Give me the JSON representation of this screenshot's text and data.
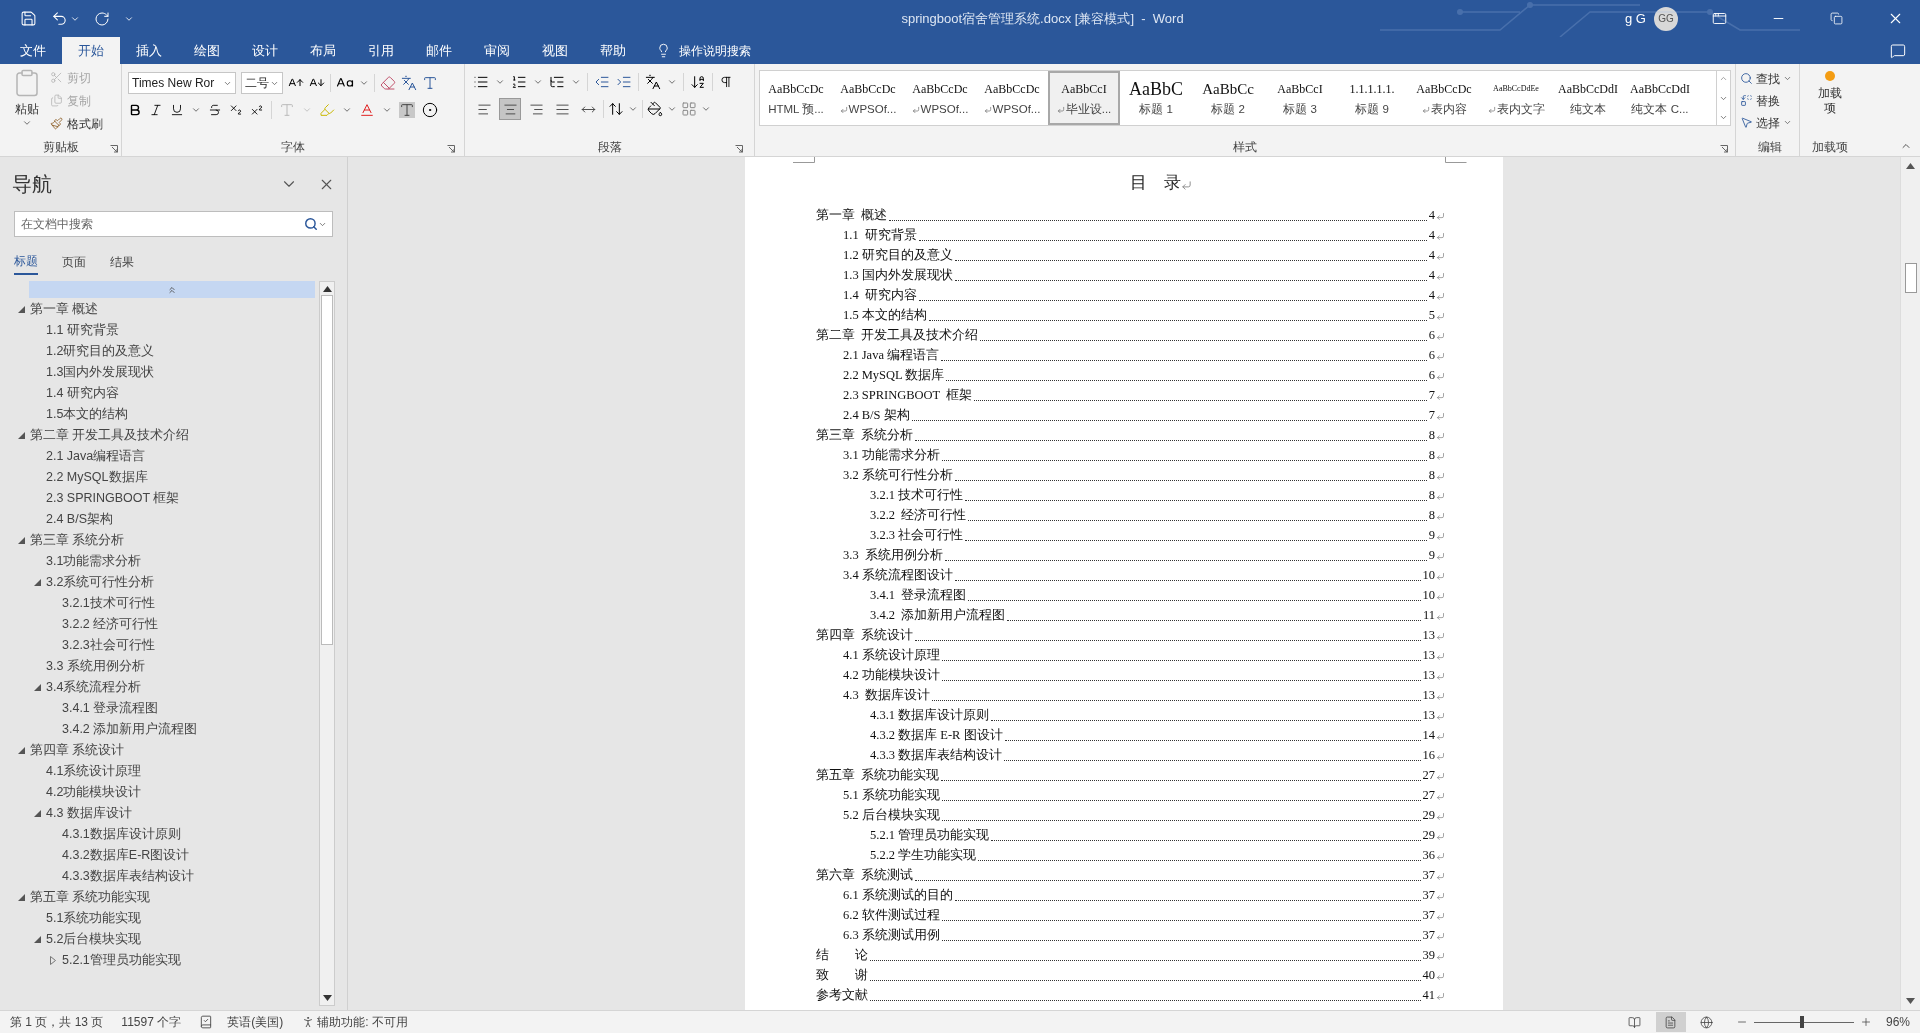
{
  "window": {
    "title": "springboot宿舍管理系统.docx [兼容模式]  -  Word",
    "user": "g G",
    "avatar": "GG"
  },
  "tabs": [
    {
      "label": "文件",
      "selected": false
    },
    {
      "label": "开始",
      "selected": true
    },
    {
      "label": "插入",
      "selected": false
    },
    {
      "label": "绘图",
      "selected": false
    },
    {
      "label": "设计",
      "selected": false
    },
    {
      "label": "布局",
      "selected": false
    },
    {
      "label": "引用",
      "selected": false
    },
    {
      "label": "邮件",
      "selected": false
    },
    {
      "label": "审阅",
      "selected": false
    },
    {
      "label": "视图",
      "selected": false
    },
    {
      "label": "帮助",
      "selected": false
    }
  ],
  "tell_me": "操作说明搜索",
  "ribbon": {
    "clipboard": {
      "group": "剪贴板",
      "paste": {
        "label": "粘贴",
        "disabled": true
      },
      "items": [
        {
          "kind": "cut",
          "label": "剪切",
          "disabled": true
        },
        {
          "kind": "copy",
          "label": "复制",
          "disabled": true
        },
        {
          "kind": "painter",
          "label": "格式刷",
          "disabled": false
        }
      ]
    },
    "font": {
      "group": "字体",
      "name": "Times New Ror",
      "size": "二号"
    },
    "paragraph": {
      "group": "段落",
      "align_buttons": [
        {
          "kind": "left",
          "selected": false
        },
        {
          "kind": "center",
          "selected": true
        },
        {
          "kind": "right",
          "selected": false
        },
        {
          "kind": "justify",
          "selected": false
        },
        {
          "kind": "distributed",
          "selected": false
        }
      ]
    },
    "styles": {
      "group": "样式",
      "items": [
        {
          "preview": "AaBbCcDc",
          "label": "HTML 预...",
          "kind": "normal",
          "linked": false,
          "selected": false
        },
        {
          "preview": "AaBbCcDc",
          "label": "WPSOf...",
          "kind": "normal",
          "linked": true,
          "selected": false
        },
        {
          "preview": "AaBbCcDc",
          "label": "WPSOf...",
          "kind": "normal",
          "linked": true,
          "selected": false
        },
        {
          "preview": "AaBbCcDc",
          "label": "WPSOf...",
          "kind": "normal",
          "linked": true,
          "selected": false
        },
        {
          "preview": "AaBbCcI",
          "label": "毕业设...",
          "kind": "normal",
          "linked": true,
          "selected": true
        },
        {
          "preview": "AaBbC",
          "label": "标题 1",
          "kind": "title",
          "linked": false,
          "selected": false
        },
        {
          "preview": "AaBbCc",
          "label": "标题 2",
          "kind": "heading",
          "linked": false,
          "selected": false
        },
        {
          "preview": "AaBbCcI",
          "label": "标题 3",
          "kind": "normal",
          "linked": false,
          "selected": false
        },
        {
          "preview": "1.1.1.1.1.",
          "label": "标题 9",
          "kind": "normal",
          "linked": false,
          "selected": false
        },
        {
          "preview": "AaBbCcDc",
          "label": "表内容",
          "kind": "normal",
          "linked": true,
          "selected": false
        },
        {
          "preview": "AaBbCcDdEe",
          "label": "表内文字",
          "kind": "small",
          "linked": true,
          "selected": false
        },
        {
          "preview": "AaBbCcDdI",
          "label": "纯文本",
          "kind": "normal",
          "linked": false,
          "selected": false
        },
        {
          "preview": "AaBbCcDdI",
          "label": "纯文本 C...",
          "kind": "normal",
          "linked": false,
          "selected": false
        }
      ]
    },
    "editing": {
      "group": "编辑",
      "items": [
        {
          "kind": "find",
          "label": "查找"
        },
        {
          "kind": "replace",
          "label": "替换"
        },
        {
          "kind": "select",
          "label": "选择"
        }
      ]
    },
    "addins": {
      "group": "加载项",
      "button": "加载项"
    }
  },
  "nav": {
    "title": "导航",
    "search": {
      "placeholder": "在文档中搜索"
    },
    "tabs": [
      {
        "label": "标题",
        "selected": true
      },
      {
        "label": "页面",
        "selected": false
      },
      {
        "label": "结果",
        "selected": false
      }
    ],
    "tree": [
      {
        "label": "第一章 概述",
        "expanded": true,
        "children": [
          {
            "label": "1.1 研究背景"
          },
          {
            "label": "1.2研究目的及意义"
          },
          {
            "label": "1.3国内外发展现状"
          },
          {
            "label": "1.4 研究内容"
          },
          {
            "label": "1.5本文的结构"
          }
        ]
      },
      {
        "label": "第二章 开发工具及技术介绍",
        "expanded": true,
        "children": [
          {
            "label": "2.1 Java编程语言"
          },
          {
            "label": "2.2 MySQL数据库"
          },
          {
            "label": "2.3 SPRINGBOOT 框架"
          },
          {
            "label": "2.4 B/S架构"
          }
        ]
      },
      {
        "label": "第三章 系统分析",
        "expanded": true,
        "children": [
          {
            "label": "3.1功能需求分析"
          },
          {
            "label": "3.2系统可行性分析",
            "expanded": true,
            "children": [
              {
                "label": "3.2.1技术可行性"
              },
              {
                "label": "3.2.2 经济可行性"
              },
              {
                "label": "3.2.3社会可行性"
              }
            ]
          },
          {
            "label": "3.3 系统用例分析"
          },
          {
            "label": "3.4系统流程分析",
            "expanded": true,
            "children": [
              {
                "label": "3.4.1 登录流程图"
              },
              {
                "label": "3.4.2 添加新用户流程图"
              }
            ]
          }
        ]
      },
      {
        "label": "第四章 系统设计",
        "expanded": true,
        "children": [
          {
            "label": "4.1系统设计原理"
          },
          {
            "label": "4.2功能模块设计"
          },
          {
            "label": "4.3 数据库设计",
            "expanded": true,
            "children": [
              {
                "label": "4.3.1数据库设计原则"
              },
              {
                "label": "4.3.2数据库E-R图设计"
              },
              {
                "label": "4.3.3数据库表结构设计"
              }
            ]
          }
        ]
      },
      {
        "label": "第五章 系统功能实现",
        "expanded": true,
        "children": [
          {
            "label": "5.1系统功能实现"
          },
          {
            "label": "5.2后台模块实现",
            "expanded": true,
            "children": [
              {
                "label": "5.2.1管理员功能实现",
                "expanded": false
              }
            ]
          }
        ]
      }
    ]
  },
  "document": {
    "title": "目　录",
    "toc": [
      {
        "title": "第一章  概述",
        "page": "4",
        "children": [
          {
            "title": "1.1  研究背景",
            "page": "4"
          },
          {
            "title": "1.2 研究目的及意义",
            "page": "4"
          },
          {
            "title": "1.3 国内外发展现状",
            "page": "4"
          },
          {
            "title": "1.4  研究内容",
            "page": "4"
          },
          {
            "title": "1.5 本文的结构",
            "page": "5"
          }
        ]
      },
      {
        "title": "第二章  开发工具及技术介绍",
        "page": "6",
        "children": [
          {
            "title": "2.1 Java 编程语言",
            "page": "6"
          },
          {
            "title": "2.2 MySQL 数据库",
            "page": "6"
          },
          {
            "title": "2.3 SPRINGBOOT  框架",
            "page": "7"
          },
          {
            "title": "2.4 B/S 架构",
            "page": "7"
          }
        ]
      },
      {
        "title": "第三章  系统分析",
        "page": "8",
        "children": [
          {
            "title": "3.1 功能需求分析",
            "page": "8"
          },
          {
            "title": "3.2 系统可行性分析",
            "page": "8",
            "children": [
              {
                "title": "3.2.1 技术可行性",
                "page": "8"
              },
              {
                "title": "3.2.2  经济可行性",
                "page": "8"
              },
              {
                "title": "3.2.3 社会可行性",
                "page": "9"
              }
            ]
          },
          {
            "title": "3.3  系统用例分析",
            "page": "9"
          },
          {
            "title": "3.4 系统流程图设计",
            "page": "10",
            "children": [
              {
                "title": "3.4.1  登录流程图",
                "page": "10"
              },
              {
                "title": "3.4.2  添加新用户流程图",
                "page": "11"
              }
            ]
          }
        ]
      },
      {
        "title": "第四章  系统设计",
        "page": "13",
        "children": [
          {
            "title": "4.1 系统设计原理",
            "page": "13"
          },
          {
            "title": "4.2 功能模块设计",
            "page": "13"
          },
          {
            "title": "4.3  数据库设计",
            "page": "13",
            "children": [
              {
                "title": "4.3.1 数据库设计原则",
                "page": "13"
              },
              {
                "title": "4.3.2 数据库 E-R 图设计",
                "page": "14"
              },
              {
                "title": "4.3.3 数据库表结构设计",
                "page": "16"
              }
            ]
          }
        ]
      },
      {
        "title": "第五章  系统功能实现",
        "page": "27",
        "children": [
          {
            "title": "5.1 系统功能实现",
            "page": "27"
          },
          {
            "title": "5.2 后台模块实现",
            "page": "29",
            "children": [
              {
                "title": "5.2.1 管理员功能实现",
                "page": "29"
              },
              {
                "title": "5.2.2 学生功能实现",
                "page": "36"
              }
            ]
          }
        ]
      },
      {
        "title": "第六章  系统测试",
        "page": "37",
        "children": [
          {
            "title": "6.1 系统测试的目的",
            "page": "37"
          },
          {
            "title": "6.2 软件测试过程",
            "page": "37"
          },
          {
            "title": "6.3 系统测试用例",
            "page": "37"
          }
        ]
      },
      {
        "title": "结　　论",
        "page": "39"
      },
      {
        "title": "致　　谢",
        "page": "40"
      },
      {
        "title": "参考文献",
        "page": "41"
      }
    ]
  },
  "status_bar": {
    "page": "第 1 页，共 13 页",
    "words": "11597 个字",
    "language": "英语(美国)",
    "accessibility": "辅助功能: 不可用",
    "views": [
      {
        "kind": "read",
        "selected": false
      },
      {
        "kind": "print",
        "selected": true
      },
      {
        "kind": "web",
        "selected": false
      }
    ],
    "zoom": {
      "level": 0.48,
      "reading": "96%"
    }
  }
}
